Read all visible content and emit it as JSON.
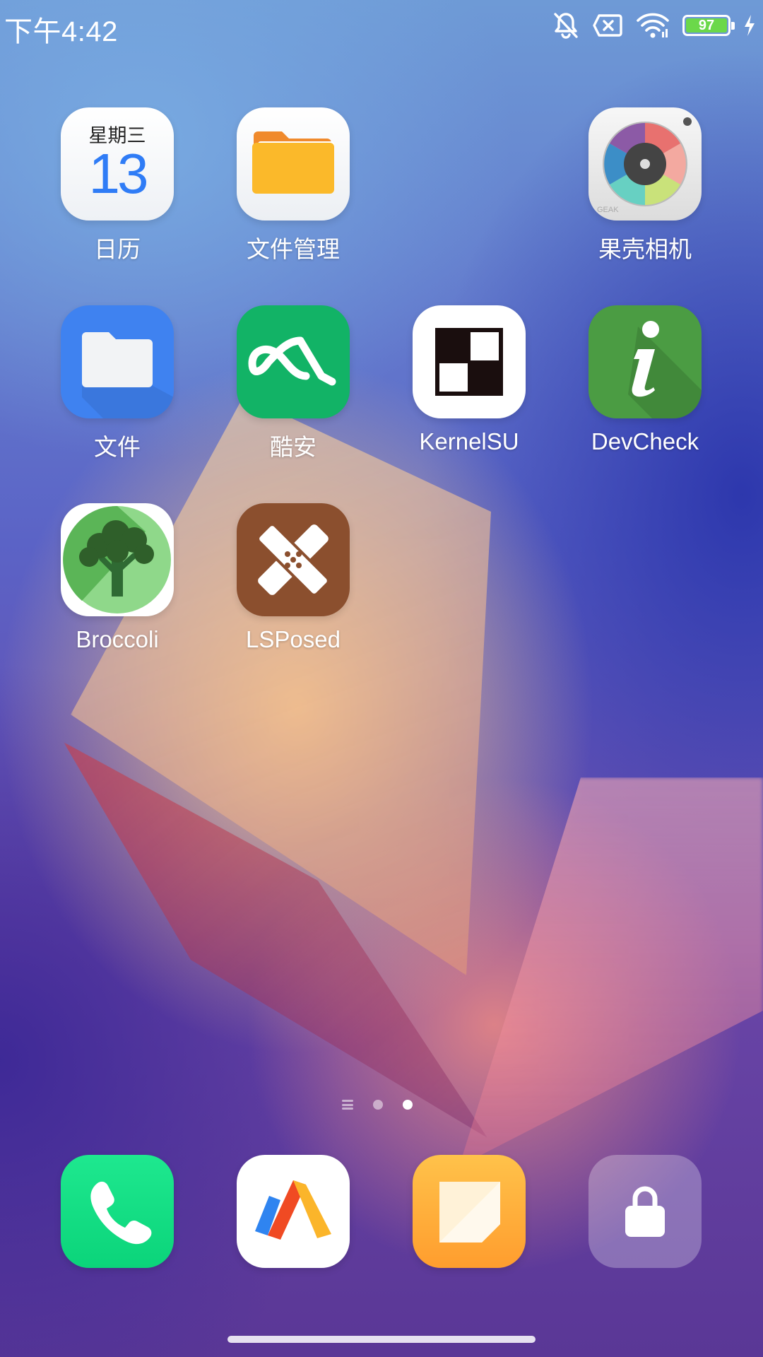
{
  "status_bar": {
    "time": "下午4:42",
    "battery_level": "97",
    "icons": [
      "mute-icon",
      "no-sim-icon",
      "wifi-icon",
      "battery-icon",
      "charging-icon"
    ]
  },
  "apps": [
    {
      "label": "日历",
      "icon": "calendar-icon",
      "weekday": "星期三",
      "day": "13"
    },
    {
      "label": "文件管理",
      "icon": "file-manager-icon"
    },
    {
      "label": "果壳相机",
      "icon": "camera-icon",
      "brand": "GEAK"
    },
    {
      "label": "文件",
      "icon": "files-icon"
    },
    {
      "label": "酷安",
      "icon": "coolapk-icon"
    },
    {
      "label": "KernelSU",
      "icon": "kernelsu-icon"
    },
    {
      "label": "DevCheck",
      "icon": "devcheck-icon"
    },
    {
      "label": "Broccoli",
      "icon": "broccoli-icon"
    },
    {
      "label": "LSPosed",
      "icon": "lsposed-icon"
    }
  ],
  "dock": [
    {
      "icon": "phone-icon"
    },
    {
      "icon": "browser-icon"
    },
    {
      "icon": "notes-icon"
    },
    {
      "icon": "lock-icon"
    }
  ],
  "pager": {
    "pages": 2,
    "current": 2
  }
}
